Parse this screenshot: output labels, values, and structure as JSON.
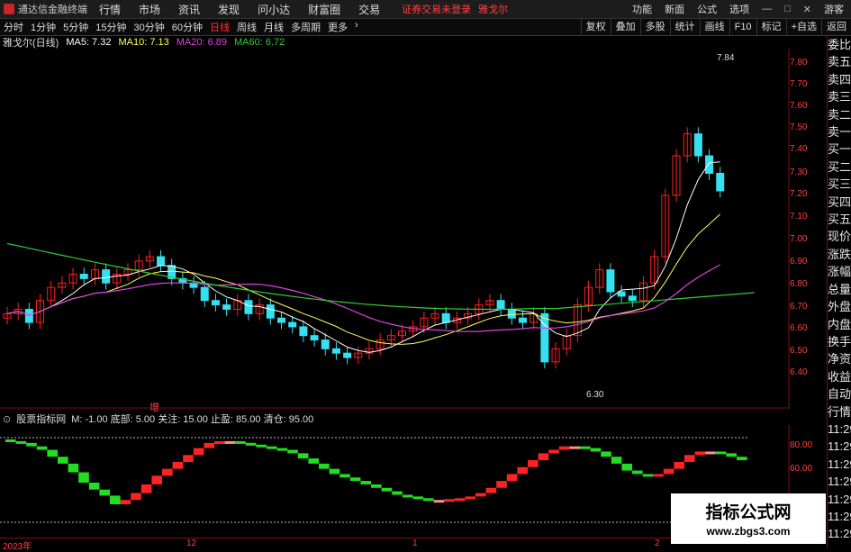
{
  "app": {
    "name": "通达信金融终端"
  },
  "menu": [
    "行情",
    "市场",
    "资讯",
    "发现",
    "问小达",
    "财富圈",
    "交易"
  ],
  "notice": "证券交易未登录",
  "stock_name": "雅戈尔",
  "topright": [
    "功能",
    "新面",
    "公式",
    "选项",
    "游客"
  ],
  "periods": [
    "分时",
    "1分钟",
    "5分钟",
    "15分钟",
    "30分钟",
    "60分钟",
    "日线",
    "周线",
    "月线",
    "多周期",
    "更多"
  ],
  "active_period": "日线",
  "tools": [
    "复权",
    "叠加",
    "多股",
    "统计",
    "画线",
    "F10",
    "标记",
    "+自选",
    "返回"
  ],
  "ma_info": {
    "title": "雅戈尔(日线)",
    "ma5": "MA5: 7.32",
    "ma10": "MA10: 7.13",
    "ma20": "MA20: 6.89",
    "ma60": "MA60: 6.72",
    "colors": {
      "ma5": "#ffffff",
      "ma10": "#ffff55",
      "ma20": "#dd44dd",
      "ma60": "#33cc33"
    }
  },
  "price_axis": [
    "7.80",
    "7.70",
    "7.60",
    "7.50",
    "7.40",
    "7.30",
    "7.20",
    "7.10",
    "7.00",
    "6.90",
    "6.80",
    "6.70",
    "6.60",
    "6.50",
    "6.40"
  ],
  "high_label": "7.84",
  "low_label": "6.30",
  "zeng_label": "增",
  "indicator": {
    "name": "股票指标网",
    "params": "M: -1.00  底部: 5.00  关注: 15.00  止盈: 85.00  清仓: 95.00",
    "axis": [
      "80.00",
      "60.00"
    ]
  },
  "time_labels": [
    "2023年",
    "12",
    "1",
    "2"
  ],
  "side_labels": [
    "委比",
    "卖五",
    "卖四",
    "卖三",
    "卖二",
    "卖一",
    "买一",
    "买二",
    "买三",
    "买四",
    "买五",
    "现价",
    "涨跌",
    "涨幅",
    "总量",
    "外盘",
    "内盘",
    "换手",
    "净资",
    "收益",
    "自动",
    "行情",
    "11:29",
    "11:29",
    "11:29",
    "11:29",
    "11:29",
    "11:29",
    "11:29"
  ],
  "watermark": {
    "line1": "指标公式网",
    "line2": "www.zbgs3.com"
  },
  "colors": {
    "up": "#ff2020",
    "down": "#35e0f0",
    "ind_up": "#ff2222",
    "ind_down": "#22dd22",
    "ind_pink": "#ff9090"
  }
}
